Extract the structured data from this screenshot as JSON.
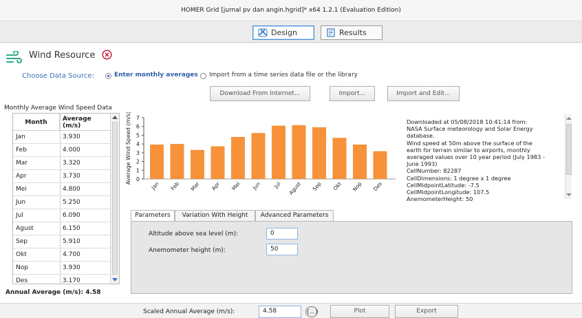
{
  "window": {
    "title": "HOMER Grid [jurnal pv dan angin.hgrid]*  x64 1.2.1 (Evaluation Edition)"
  },
  "top_tabs": [
    {
      "label": "Design",
      "icon": "design-icon",
      "active": true
    },
    {
      "label": "Results",
      "icon": "results-icon",
      "active": false
    }
  ],
  "resource": {
    "title": "Wind Resource",
    "icon": "wind-icon",
    "close_icon": "close-circle-icon"
  },
  "data_source": {
    "label": "Choose Data Source:",
    "options": [
      {
        "label": "Enter monthly averages",
        "selected": true
      },
      {
        "label": "Import from a time series data file or the library",
        "selected": false
      }
    ]
  },
  "actions": {
    "download": "Download From Internet...",
    "import": "Import...",
    "import_edit": "Import and Edit..."
  },
  "section_label": "Monthly Average Wind Speed Data",
  "table": {
    "headers": {
      "month": "Month",
      "average": "Average\n(m/s)"
    },
    "rows": [
      {
        "month": "Jan",
        "value": "3.930"
      },
      {
        "month": "Feb",
        "value": "4.000"
      },
      {
        "month": "Mar",
        "value": "3.320"
      },
      {
        "month": "Apr",
        "value": "3.730"
      },
      {
        "month": "Mei",
        "value": "4.800"
      },
      {
        "month": "Jun",
        "value": "5.250"
      },
      {
        "month": "Jul",
        "value": "6.090"
      },
      {
        "month": "Agust",
        "value": "6.150"
      },
      {
        "month": "Sep",
        "value": "5.910"
      },
      {
        "month": "Okt",
        "value": "4.700"
      },
      {
        "month": "Nop",
        "value": "3.930"
      },
      {
        "month": "Des",
        "value": "3.170"
      }
    ]
  },
  "annual_average": "Annual Average (m/s): 4.58",
  "chart_data": {
    "type": "bar",
    "categories": [
      "Jan",
      "Feb",
      "Mar",
      "Apr",
      "Mei",
      "Jun",
      "Jul",
      "Agust",
      "Sep",
      "Okt",
      "Nop",
      "Des"
    ],
    "values": [
      3.93,
      4.0,
      3.32,
      3.73,
      4.8,
      5.25,
      6.09,
      6.15,
      5.91,
      4.7,
      3.93,
      3.17
    ],
    "ylabel": "Average Wind Speed (m/s)",
    "ylim": [
      0,
      7
    ],
    "yticks": [
      "0",
      "1",
      "2",
      "3",
      "4",
      "5",
      "6",
      "7"
    ],
    "bar_color": "#f7923a",
    "grid": false
  },
  "description": "Downloaded at 05/08/2018 10:41:14 from:\nNASA Surface meteorology and Solar Energy\ndatabase.\nWind speed at 50m above the surface of the\nearth for terrain similar to airports, monthly\naveraged values over 10 year period (July 1983 -\nJune 1993)\nCellNumber: 82287\nCellDimensions: 1 degree x 1 degree\nCellMidpointLatitude: -7.5\nCellMidpointLongitude: 107.5\nAnemometerHeight: 50",
  "param_tabs": [
    {
      "label": "Parameters",
      "active": true
    },
    {
      "label": "Variation With Height",
      "active": false
    },
    {
      "label": "Advanced Parameters",
      "active": false
    }
  ],
  "params": {
    "altitude_label": "Altitude above sea level (m):",
    "altitude_value": "0",
    "anemometer_label": "Anemometer height (m):",
    "anemometer_value": "50"
  },
  "bottom": {
    "scaled_label": "Scaled Annual Average (m/s):",
    "scaled_value": "4.58",
    "sensitivity_label": "{...}",
    "plot": "Plot",
    "export": "Export"
  }
}
